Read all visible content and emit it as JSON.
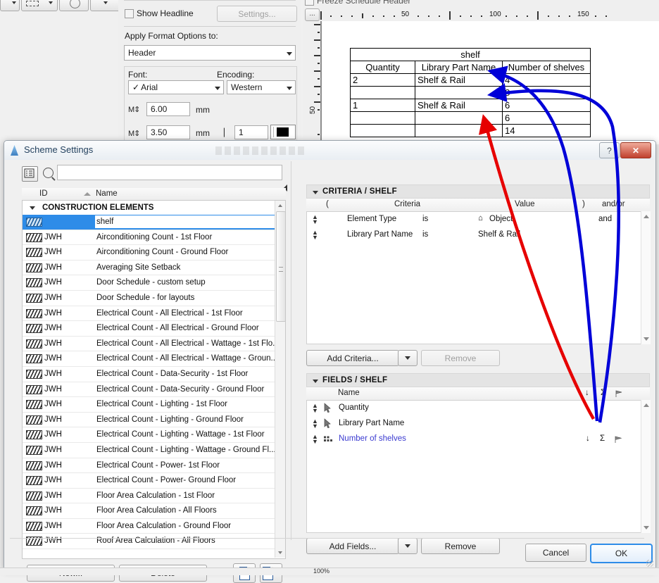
{
  "background": {
    "freeze_label": "Freeze Schedule Header",
    "show_headline_label": "Show Headline",
    "settings_button": "Settings...",
    "apply_format_label": "Apply Format Options to:",
    "apply_format_value": "Header",
    "font_label": "Font:",
    "encoding_label": "Encoding:",
    "font_value": "Arial",
    "encoding_value": "Western",
    "size1_value": "6.00",
    "size1_unit": "mm",
    "size2_value": "3.50",
    "size2_unit": "mm",
    "pen_value": "1",
    "pen_color": "#000000",
    "dots_button": "...",
    "ruler": {
      "h_labels": [
        "50",
        "100",
        "150"
      ],
      "v_labels": [
        "50"
      ]
    }
  },
  "schedule_table": {
    "title": "shelf",
    "columns": [
      "Quantity",
      "Library Part Name",
      "Number of shelves"
    ],
    "rows": [
      [
        "2",
        "Shelf & Rail",
        "4"
      ],
      [
        "",
        "",
        "8"
      ],
      [
        "1",
        "Shelf & Rail",
        "6"
      ],
      [
        "",
        "",
        "6"
      ],
      [
        "",
        "",
        "14"
      ]
    ]
  },
  "dialog": {
    "title": "Scheme Settings",
    "help_icon": "?",
    "close_icon": "✕",
    "search": {
      "placeholder": ""
    },
    "list_header": {
      "id": "ID",
      "name": "Name"
    },
    "group_label": "CONSTRUCTION ELEMENTS",
    "items": [
      {
        "id": "",
        "name": "shelf",
        "selected": true
      },
      {
        "id": "JWH",
        "name": "Airconditioning Count - 1st Floor"
      },
      {
        "id": "JWH",
        "name": "Airconditioning Count - Ground Floor"
      },
      {
        "id": "JWH",
        "name": "Averaging Site Setback"
      },
      {
        "id": "JWH",
        "name": "Door Schedule - custom setup"
      },
      {
        "id": "JWH",
        "name": "Door Schedule - for layouts"
      },
      {
        "id": "JWH",
        "name": "Electrical Count - All Electrical - 1st Floor"
      },
      {
        "id": "JWH",
        "name": "Electrical Count - All Electrical - Ground Floor"
      },
      {
        "id": "JWH",
        "name": "Electrical Count - All Electrical - Wattage - 1st Flo..."
      },
      {
        "id": "JWH",
        "name": "Electrical Count - All Electrical - Wattage - Groun..."
      },
      {
        "id": "JWH",
        "name": "Electrical Count - Data-Security - 1st Floor"
      },
      {
        "id": "JWH",
        "name": "Electrical Count - Data-Security - Ground Floor"
      },
      {
        "id": "JWH",
        "name": "Electrical Count - Lighting - 1st Floor"
      },
      {
        "id": "JWH",
        "name": "Electrical Count - Lighting - Ground Floor"
      },
      {
        "id": "JWH",
        "name": "Electrical Count - Lighting - Wattage - 1st Floor"
      },
      {
        "id": "JWH",
        "name": "Electrical Count - Lighting - Wattage - Ground Fl..."
      },
      {
        "id": "JWH",
        "name": "Electrical Count - Power- 1st Floor"
      },
      {
        "id": "JWH",
        "name": "Electrical Count - Power- Ground Floor"
      },
      {
        "id": "JWH",
        "name": "Floor Area Calculation - 1st Floor"
      },
      {
        "id": "JWH",
        "name": "Floor Area Calculation - All Floors"
      },
      {
        "id": "JWH",
        "name": "Floor Area Calculation - Ground Floor"
      },
      {
        "id": "JWH",
        "name": "Roof Area Calculation - All Floors"
      }
    ],
    "buttons": {
      "new": "New...",
      "delete": "Delete",
      "add_criteria": "Add Criteria...",
      "remove_criteria": "Remove",
      "add_fields": "Add Fields...",
      "remove_fields": "Remove",
      "cancel": "Cancel",
      "ok": "OK"
    },
    "criteria_section": {
      "title": "CRITERIA / SHELF",
      "columns": [
        "(",
        "Criteria",
        "",
        "Value",
        ")",
        "and/or"
      ],
      "rows": [
        {
          "criteria": "Element Type",
          "op": "is",
          "value": "Object",
          "has_icon": true,
          "andor": "and"
        },
        {
          "criteria": "Library Part Name",
          "op": "is",
          "value": "Shelf & Rail",
          "has_icon": false,
          "andor": ""
        }
      ]
    },
    "fields_section": {
      "title": "FIELDS / SHELF",
      "columns": [
        "Name"
      ],
      "col_icons": [
        "↓",
        "Σ",
        "flag"
      ],
      "rows": [
        {
          "name": "Quantity",
          "icon": "pointer-icon",
          "highlighted": false,
          "sort": "",
          "sum": "",
          "flag": ""
        },
        {
          "name": "Library Part Name",
          "icon": "pointer-icon",
          "highlighted": false,
          "sort": "",
          "sum": "",
          "flag": ""
        },
        {
          "name": "Number of shelves",
          "icon": "grid-icon",
          "highlighted": true,
          "sort": "↓",
          "sum": "Σ",
          "flag": "flag"
        }
      ]
    }
  },
  "statusbar": {
    "zoom": "100%"
  },
  "annotations": {
    "red_color": "#e60000",
    "blue_color": "#0000d8",
    "red_arrow": "points from Number-of-shelves sum icon up to the 14 total cell",
    "blue_arrows": "two arrows from the sum/flag icons up to the 8 and 6 subtotal cells"
  },
  "colors": {
    "accent": "#2e8ce8",
    "title_text": "#24425f",
    "close_red": "#c0402e",
    "field_highlight": "#3b3bd0"
  }
}
